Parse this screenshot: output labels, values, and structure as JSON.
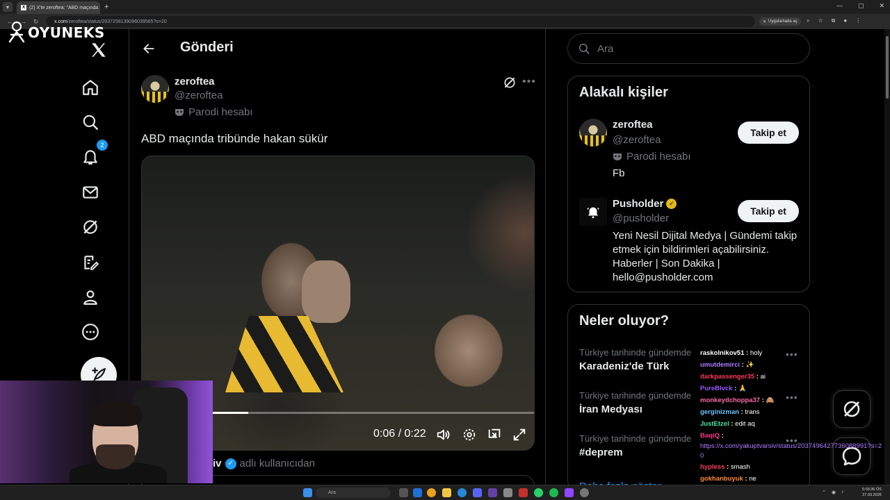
{
  "browser": {
    "tab_title": "(2) X'te zeroftea: \"ABD maçında",
    "url_host": "x.com",
    "url_path": "/zeroftea/status/2037258139096039565?s=20",
    "open_in_app": "Uygulamada aç"
  },
  "overlay_logo": "OYUNEKS",
  "nav": {
    "notifications_badge": "2"
  },
  "header": {
    "title": "Gönderi"
  },
  "tweet": {
    "display_name": "zeroftea",
    "handle": "@zeroftea",
    "parody_label": "Parodi hesabı",
    "text": "ABD maçında tribünde hakan sükür",
    "video_time": "0:06 / 0:22",
    "video_progress": 0.27,
    "from_user_name": "iv",
    "from_user_suffix": "adlı kullanıcıdan"
  },
  "search": {
    "placeholder": "Ara"
  },
  "related": {
    "title": "Alakalı kişiler",
    "people": [
      {
        "name": "zeroftea",
        "handle": "@zeroftea",
        "parody_label": "Parodi hesabı",
        "bio": "Fb",
        "follow_label": "Takip et"
      },
      {
        "name": "Pusholder",
        "handle": "@pusholder",
        "bio": "Yeni Nesil Dijital Medya | Gündemi takip etmek için bildirimleri açabilirsiniz. Haberler | Son Dakika | hello@pusholder.com",
        "follow_label": "Takip et"
      }
    ]
  },
  "trends": {
    "title": "Neler oluyor?",
    "items": [
      {
        "meta": "Türkiye tarihinde gündemde",
        "name": "Karadeniz'de Türk"
      },
      {
        "meta": "Türkiye tarihinde gündemde",
        "name": "İran Medyası"
      },
      {
        "meta": "Türkiye tarihinde gündemde",
        "name": "#deprem"
      }
    ],
    "partial_next": "Daha fazla göster"
  },
  "chat": [
    {
      "user": "raskolnikov51",
      "color": "#ffffff",
      "msg": "holy"
    },
    {
      "user": "umutdemirci",
      "color": "#b07cff",
      "msg": "✨"
    },
    {
      "user": "darkpassenger35",
      "color": "#ff3a5c",
      "msg": "ai"
    },
    {
      "user": "PureBlvck",
      "color": "#9b59ff",
      "msg": "🙏"
    },
    {
      "user": "monkeydchoppa37",
      "color": "#ff6aa8",
      "msg": "🙈"
    },
    {
      "user": "gerginizman",
      "color": "#6fc3ff",
      "msg": "trans"
    },
    {
      "user": "JustEtzel",
      "color": "#4de1a1",
      "msg": "edit aq"
    },
    {
      "user": "BaqiQ",
      "color": "#ff3a8c",
      "msg": ""
    },
    {
      "user": "",
      "color": "#b07cff",
      "msg": "https://x.com/yakuptvarsiv/status/2037496427736088991?s=20",
      "link": true
    },
    {
      "user": "hypless",
      "color": "#ff3a5c",
      "msg": "smash"
    },
    {
      "user": "gokhanbuyuk",
      "color": "#ff8a3a",
      "msg": "ne"
    }
  ],
  "taskbar": {
    "search_placeholder": "Ara",
    "time": "5:03:36 ÖS",
    "date": "27.03.2026"
  },
  "colors": {
    "accent": "#1d9bf0",
    "background": "#000000",
    "border": "#2f3336",
    "muted": "#71767b"
  }
}
